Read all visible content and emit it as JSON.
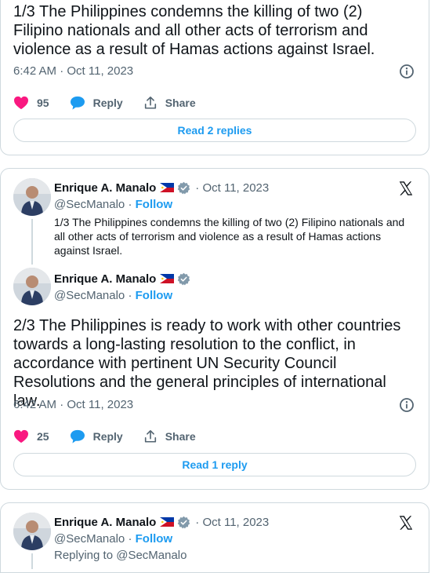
{
  "tweet1": {
    "text": "1/3 The Philippines condemns the killing of two (2) Filipino nationals and all other acts of terrorism and violence as a result of Hamas actions against Israel.",
    "time": "6:42 AM · Oct 11, 2023",
    "likes": "95",
    "reply_label": "Reply",
    "share_label": "Share",
    "read_replies": "Read 2 replies"
  },
  "tweet2": {
    "parent": {
      "name": "Enrique A. Manalo",
      "date": "· Oct 11, 2023",
      "handle": "@SecManalo",
      "separator": " · ",
      "follow": "Follow",
      "text": "1/3 The Philippines condemns the killing of two (2) Filipino nationals and all other acts of terrorism and violence as a result of Hamas actions against Israel."
    },
    "main": {
      "name": "Enrique A. Manalo",
      "handle": "@SecManalo",
      "separator": " · ",
      "follow": "Follow",
      "text": "2/3 The Philippines is ready to work with other countries towards a long-lasting resolution to the conflict, in accordance with pertinent UN Security Council Resolutions and the general principles of international law.",
      "time": "6:42 AM · Oct 11, 2023",
      "likes": "25",
      "reply_label": "Reply",
      "share_label": "Share",
      "read_replies": "Read 1 reply"
    }
  },
  "tweet3": {
    "name": "Enrique A. Manalo",
    "date": "· Oct 11, 2023",
    "handle": "@SecManalo",
    "separator": " · ",
    "follow": "Follow",
    "replying": "Replying to @SecManalo"
  },
  "colors": {
    "like": "#f91880",
    "reply": "#1d9bf0",
    "link": "#1d9bf0",
    "muted": "#536471",
    "verified": "#829aab"
  },
  "icons": [
    "heart-icon",
    "reply-bubble-icon",
    "share-icon",
    "info-icon",
    "x-logo-icon",
    "verified-badge-icon",
    "philippines-flag-icon"
  ]
}
